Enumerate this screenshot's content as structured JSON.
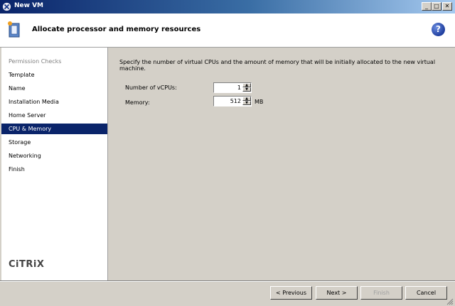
{
  "window": {
    "title": "New VM"
  },
  "header": {
    "title": "Allocate processor and memory resources"
  },
  "sidebar": {
    "items": [
      {
        "label": "Permission Checks",
        "state": "disabled"
      },
      {
        "label": "Template",
        "state": "normal"
      },
      {
        "label": "Name",
        "state": "normal"
      },
      {
        "label": "Installation Media",
        "state": "normal"
      },
      {
        "label": "Home Server",
        "state": "normal"
      },
      {
        "label": "CPU & Memory",
        "state": "selected"
      },
      {
        "label": "Storage",
        "state": "normal"
      },
      {
        "label": "Networking",
        "state": "normal"
      },
      {
        "label": "Finish",
        "state": "normal"
      }
    ],
    "logo_text": "CiTRiX"
  },
  "main": {
    "instruction": "Specify the number of virtual CPUs and the amount of memory that will be initially allocated to the new virtual machine.",
    "vcpus_label": "Number of vCPUs:",
    "vcpus_value": "1",
    "memory_label": "Memory:",
    "memory_value": "512",
    "memory_unit": "MB"
  },
  "footer": {
    "previous": "< Previous",
    "next": "Next >",
    "finish": "Finish",
    "cancel": "Cancel"
  }
}
